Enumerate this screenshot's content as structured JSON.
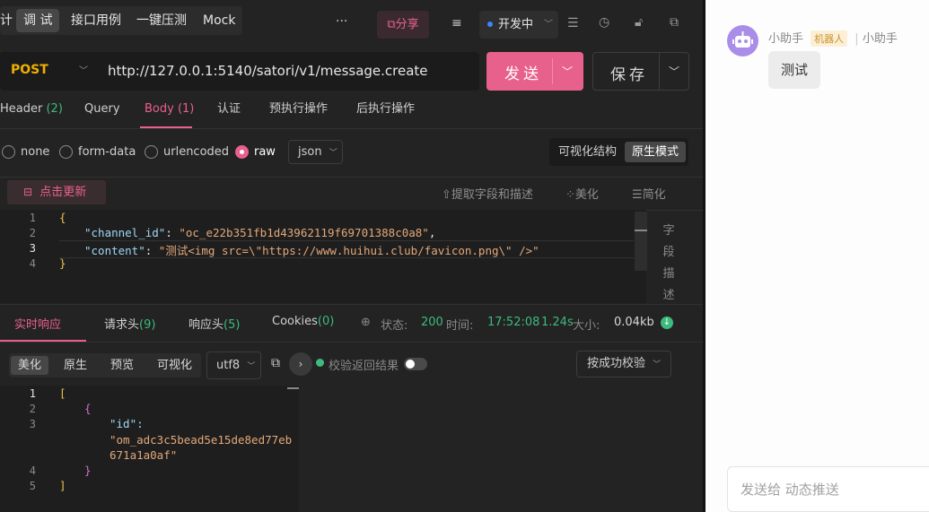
{
  "top_tabs": [
    {
      "label": "调 试",
      "active": true
    },
    {
      "label": "接口用例",
      "active": false
    },
    {
      "label": "一键压测",
      "active": false
    },
    {
      "label": "Mock",
      "active": false
    }
  ],
  "left_cut_glyph": "计",
  "more_dots": "···",
  "share_label": "分享",
  "env_status": "开发中",
  "request": {
    "method": "POST",
    "url": "http://127.0.0.1:5140/satori/v1/message.create",
    "send_label": "发送",
    "save_label": "保存"
  },
  "req_tabs": [
    {
      "label": "Header",
      "count": "(2)"
    },
    {
      "label": "Query",
      "count": ""
    },
    {
      "label": "Body",
      "count": "(1)"
    },
    {
      "label": "认证",
      "count": ""
    },
    {
      "label": "预执行操作",
      "count": ""
    },
    {
      "label": "后执行操作",
      "count": ""
    }
  ],
  "body_types": [
    "none",
    "form-data",
    "urlencoded",
    "raw"
  ],
  "body_format": "json",
  "view_modes": [
    "可视化结构",
    "原生模式"
  ],
  "refresh_label": "点击更新",
  "body_tools": [
    "提取字段和描述",
    "美化",
    "简化"
  ],
  "field_desc_vertical": "字段描述",
  "request_body_lines": [
    {
      "n": "1",
      "text": "{"
    },
    {
      "n": "2",
      "key": "\"channel_id\"",
      "value": "\"oc_e22b351fb1d43962119f69701388c0a8\""
    },
    {
      "n": "3",
      "key": "\"content\"",
      "value": "\"测试<img src=\\\"https://www.huihui.club/favicon.png\\\" />\""
    },
    {
      "n": "4",
      "text": "}"
    }
  ],
  "resp_tabs": [
    {
      "label": "实时响应",
      "count": ""
    },
    {
      "label": "请求头",
      "count": "(9)"
    },
    {
      "label": "响应头",
      "count": "(5)"
    },
    {
      "label": "Cookies",
      "count": "(0)"
    }
  ],
  "resp_status": {
    "status_label": "状态:",
    "status": "200",
    "time_label": "时间:",
    "time": "17:52:08",
    "duration": "1.24s",
    "size_label": "大小:",
    "size": "0.04kb"
  },
  "resp_view_buttons": [
    "美化",
    "原生",
    "预览",
    "可视化"
  ],
  "encoding": "utf8",
  "validate_label": "校验返回结果",
  "validate_mode": "按成功校验",
  "response_lines": [
    {
      "n": "1",
      "text": "["
    },
    {
      "n": "2",
      "text": "{"
    },
    {
      "n": "3",
      "key": "\"id\":",
      "value1": "\"om_adc3c5bead5e15de8ed77eb",
      "value2": "671a1a0af\""
    },
    {
      "n": "4",
      "text": "}"
    },
    {
      "n": "5",
      "text": "]"
    }
  ],
  "chat": {
    "sender": "小助手",
    "badge": "机器人",
    "channel": "小助手",
    "message": "测试",
    "input_placeholder": "发送给 动态推送"
  },
  "colors": {
    "accent": "#e8618c",
    "success": "#3dbb7c"
  }
}
